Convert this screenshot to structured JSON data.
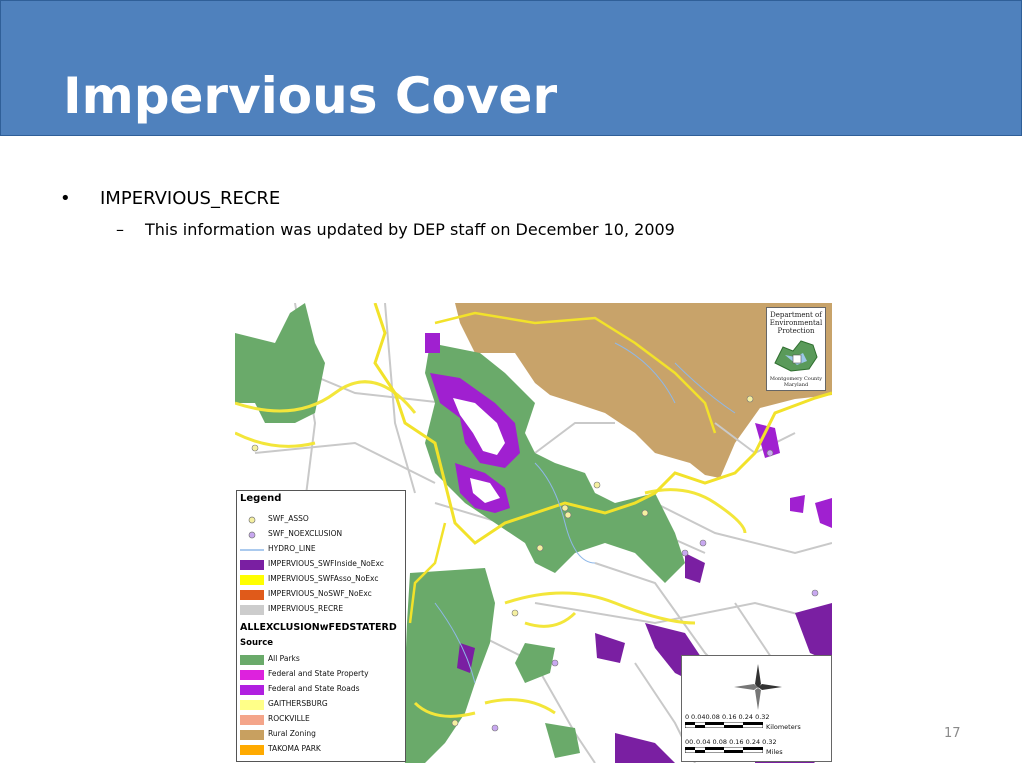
{
  "slide": {
    "title": "Impervious Cover",
    "bullet_marker": "•",
    "bullet_text": "IMPERVIOUS_RECRE",
    "sub_marker": "–",
    "sub_text": "This information was updated by DEP staff on December 10, 2009",
    "page_number": "17"
  },
  "legend": {
    "title": "Legend",
    "items": [
      {
        "label": "SWF_ASSO",
        "color": "#f5f0a0"
      },
      {
        "label": "SWF_NOEXCLUSION",
        "color": "#c8a8f0"
      },
      {
        "label": "HYDRO_LINE",
        "color": "#8fb8e8"
      },
      {
        "label": "IMPERVIOUS_SWFInside_NoExc",
        "color": "#7a1fa2"
      },
      {
        "label": "IMPERVIOUS_SWFAsso_NoExc",
        "color": "#ffff00"
      },
      {
        "label": "IMPERVIOUS_NoSWF_NoExc",
        "color": "#e05a1a"
      },
      {
        "label": "IMPERVIOUS_RECRE",
        "color": "#cccccc"
      }
    ],
    "group_title": "ALLEXCLUSIONwFEDSTATERD",
    "source_title": "Source",
    "sources": [
      {
        "label": "All Parks",
        "color": "#6aaa6a"
      },
      {
        "label": "Federal and State Property",
        "color": "#dd22dd"
      },
      {
        "label": "Federal and State Roads",
        "color": "#b020e0"
      },
      {
        "label": "GAITHERSBURG",
        "color": "#ffff88"
      },
      {
        "label": "ROCKVILLE",
        "color": "#f4a58a"
      },
      {
        "label": "Rural Zoning",
        "color": "#c8a060"
      },
      {
        "label": "TAKOMA PARK",
        "color": "#ffaa00"
      }
    ]
  },
  "logo": {
    "line1": "Department of",
    "line2": "Environmental",
    "line3": "Protection",
    "caption": "Montgomery County Maryland"
  },
  "scale": {
    "km_ticks": "0.040.08 0.16 0.24 0.32",
    "km_ticks_prefix": "0",
    "km_label": "Kilometers",
    "mi_ticks": "0.04 0.08  0.16  0.24  0.32",
    "mi_ticks_prefix": "00.",
    "mi_label": "Miles"
  }
}
